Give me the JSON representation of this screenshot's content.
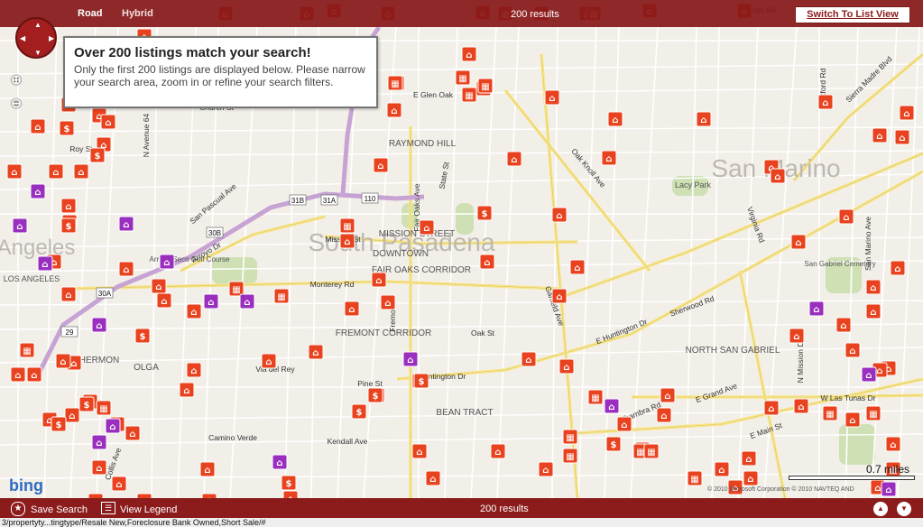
{
  "header": {
    "tab_road": "Road",
    "tab_hybrid": "Hybrid",
    "results": "200 results",
    "switch_button": "Switch To List View"
  },
  "notice": {
    "title": "Over 200 listings match your search!",
    "body": "Only the first 200 listings are displayed below. Please narrow your search area, zoom in or refine your search filters."
  },
  "footer": {
    "save_search": "Save Search",
    "view_legend": "View Legend",
    "results": "200 results"
  },
  "statusbar": "3/propertyty...tingtype/Resale New,Foreclosure Bank Owned,Short Sale/#",
  "scale_label": "0.7 miles",
  "copyright": "© 2010 Microsoft Corporation  © 2010 NAVTEQ  AND",
  "bing_logo": "bing",
  "colors": {
    "brand": "#8c1c1c",
    "marker_house": "#e8421e",
    "marker_condo": "#9a2fbf",
    "highway": "#c7a3d4",
    "park": "#cfe0b5"
  },
  "map": {
    "places": [
      {
        "name": "South Pasadena",
        "size": "large"
      },
      {
        "name": "San Marino",
        "size": "large"
      },
      {
        "name": "Angeles",
        "size": "large"
      },
      {
        "name": "RAYMOND HILL",
        "size": "small"
      },
      {
        "name": "MISSION STREET",
        "size": "small"
      },
      {
        "name": "DOWNTOWN",
        "size": "small"
      },
      {
        "name": "FAIR OAKS CORRIDOR",
        "size": "small"
      },
      {
        "name": "FREMONT CORRIDOR",
        "size": "small"
      },
      {
        "name": "HERMON",
        "size": "small"
      },
      {
        "name": "OLGA",
        "size": "small"
      },
      {
        "name": "BEAN TRACT",
        "size": "small"
      },
      {
        "name": "NORTH SAN GABRIEL",
        "size": "small"
      },
      {
        "name": "LOS ANGELES",
        "size": "small"
      },
      {
        "name": "San Gabriel Cemetery",
        "size": "small"
      },
      {
        "name": "Arroyo Seco Golf Course",
        "size": "small"
      },
      {
        "name": "Lacy Park",
        "size": "small"
      }
    ],
    "streets": [
      "Monterey Rd",
      "Mission St",
      "Huntington Dr",
      "E Huntington Dr",
      "Alhambra Rd",
      "Oak St",
      "Fremont",
      "Fair Oaks Ave",
      "Garfield Ave",
      "Arroyo Dr",
      "San Pascual Ave",
      "Virginia Rd",
      "Sherwood Rd",
      "E Grand Ave",
      "W Las Tunas Dr",
      "E Main St",
      "Orlando Rd",
      "Oxford Rd",
      "Sierra Madre Blvd",
      "Pine St",
      "Via del Rey",
      "Camino Verde",
      "Collis Ave",
      "Church St",
      "Roy St",
      "E Glen Oak",
      "State St",
      "San Marino Ave",
      "N Mission Dr",
      "Oak Knoll Ave",
      "Kendall Ave",
      "N Avenue 64"
    ],
    "highway_shields": [
      "110",
      "31A",
      "31B",
      "30B",
      "30A",
      "29"
    ]
  }
}
